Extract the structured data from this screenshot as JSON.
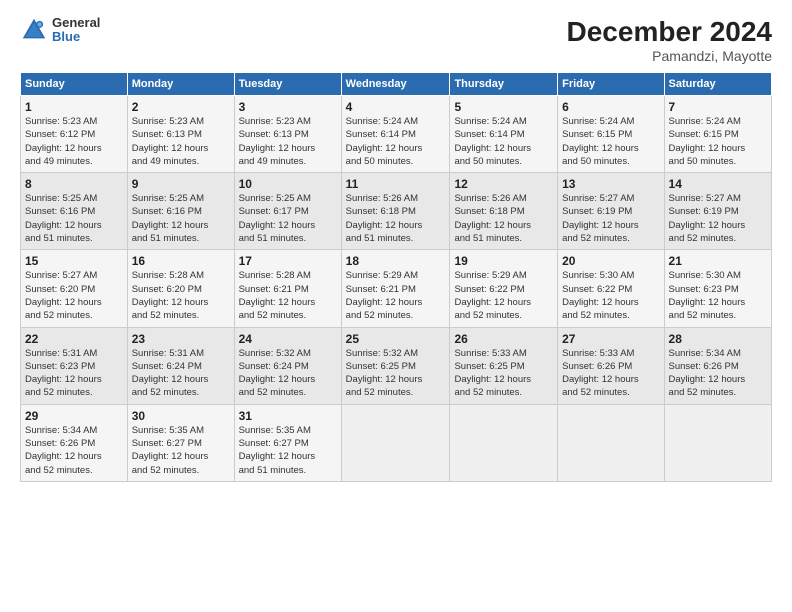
{
  "logo": {
    "general": "General",
    "blue": "Blue"
  },
  "header": {
    "title": "December 2024",
    "subtitle": "Pamandzi, Mayotte"
  },
  "calendar": {
    "days_of_week": [
      "Sunday",
      "Monday",
      "Tuesday",
      "Wednesday",
      "Thursday",
      "Friday",
      "Saturday"
    ],
    "weeks": [
      [
        null,
        null,
        null,
        null,
        {
          "day": 1,
          "sunrise": "5:23 AM",
          "sunset": "6:12 PM",
          "daylight": "12 hours and 49 minutes."
        },
        {
          "day": 2,
          "sunrise": "5:23 AM",
          "sunset": "6:13 PM",
          "daylight": "12 hours and 49 minutes."
        },
        {
          "day": 3,
          "sunrise": "5:23 AM",
          "sunset": "6:13 PM",
          "daylight": "12 hours and 49 minutes."
        },
        {
          "day": 4,
          "sunrise": "5:24 AM",
          "sunset": "6:14 PM",
          "daylight": "12 hours and 50 minutes."
        },
        {
          "day": 5,
          "sunrise": "5:24 AM",
          "sunset": "6:14 PM",
          "daylight": "12 hours and 50 minutes."
        },
        {
          "day": 6,
          "sunrise": "5:24 AM",
          "sunset": "6:15 PM",
          "daylight": "12 hours and 50 minutes."
        },
        {
          "day": 7,
          "sunrise": "5:24 AM",
          "sunset": "6:15 PM",
          "daylight": "12 hours and 50 minutes."
        }
      ],
      [
        {
          "day": 8,
          "sunrise": "5:25 AM",
          "sunset": "6:16 PM",
          "daylight": "12 hours and 51 minutes."
        },
        {
          "day": 9,
          "sunrise": "5:25 AM",
          "sunset": "6:16 PM",
          "daylight": "12 hours and 51 minutes."
        },
        {
          "day": 10,
          "sunrise": "5:25 AM",
          "sunset": "6:17 PM",
          "daylight": "12 hours and 51 minutes."
        },
        {
          "day": 11,
          "sunrise": "5:26 AM",
          "sunset": "6:18 PM",
          "daylight": "12 hours and 51 minutes."
        },
        {
          "day": 12,
          "sunrise": "5:26 AM",
          "sunset": "6:18 PM",
          "daylight": "12 hours and 51 minutes."
        },
        {
          "day": 13,
          "sunrise": "5:27 AM",
          "sunset": "6:19 PM",
          "daylight": "12 hours and 52 minutes."
        },
        {
          "day": 14,
          "sunrise": "5:27 AM",
          "sunset": "6:19 PM",
          "daylight": "12 hours and 52 minutes."
        }
      ],
      [
        {
          "day": 15,
          "sunrise": "5:27 AM",
          "sunset": "6:20 PM",
          "daylight": "12 hours and 52 minutes."
        },
        {
          "day": 16,
          "sunrise": "5:28 AM",
          "sunset": "6:20 PM",
          "daylight": "12 hours and 52 minutes."
        },
        {
          "day": 17,
          "sunrise": "5:28 AM",
          "sunset": "6:21 PM",
          "daylight": "12 hours and 52 minutes."
        },
        {
          "day": 18,
          "sunrise": "5:29 AM",
          "sunset": "6:21 PM",
          "daylight": "12 hours and 52 minutes."
        },
        {
          "day": 19,
          "sunrise": "5:29 AM",
          "sunset": "6:22 PM",
          "daylight": "12 hours and 52 minutes."
        },
        {
          "day": 20,
          "sunrise": "5:30 AM",
          "sunset": "6:22 PM",
          "daylight": "12 hours and 52 minutes."
        },
        {
          "day": 21,
          "sunrise": "5:30 AM",
          "sunset": "6:23 PM",
          "daylight": "12 hours and 52 minutes."
        }
      ],
      [
        {
          "day": 22,
          "sunrise": "5:31 AM",
          "sunset": "6:23 PM",
          "daylight": "12 hours and 52 minutes."
        },
        {
          "day": 23,
          "sunrise": "5:31 AM",
          "sunset": "6:24 PM",
          "daylight": "12 hours and 52 minutes."
        },
        {
          "day": 24,
          "sunrise": "5:32 AM",
          "sunset": "6:24 PM",
          "daylight": "12 hours and 52 minutes."
        },
        {
          "day": 25,
          "sunrise": "5:32 AM",
          "sunset": "6:25 PM",
          "daylight": "12 hours and 52 minutes."
        },
        {
          "day": 26,
          "sunrise": "5:33 AM",
          "sunset": "6:25 PM",
          "daylight": "12 hours and 52 minutes."
        },
        {
          "day": 27,
          "sunrise": "5:33 AM",
          "sunset": "6:26 PM",
          "daylight": "12 hours and 52 minutes."
        },
        {
          "day": 28,
          "sunrise": "5:34 AM",
          "sunset": "6:26 PM",
          "daylight": "12 hours and 52 minutes."
        }
      ],
      [
        {
          "day": 29,
          "sunrise": "5:34 AM",
          "sunset": "6:26 PM",
          "daylight": "12 hours and 52 minutes."
        },
        {
          "day": 30,
          "sunrise": "5:35 AM",
          "sunset": "6:27 PM",
          "daylight": "12 hours and 52 minutes."
        },
        {
          "day": 31,
          "sunrise": "5:35 AM",
          "sunset": "6:27 PM",
          "daylight": "12 hours and 51 minutes."
        },
        null,
        null,
        null,
        null
      ]
    ]
  }
}
